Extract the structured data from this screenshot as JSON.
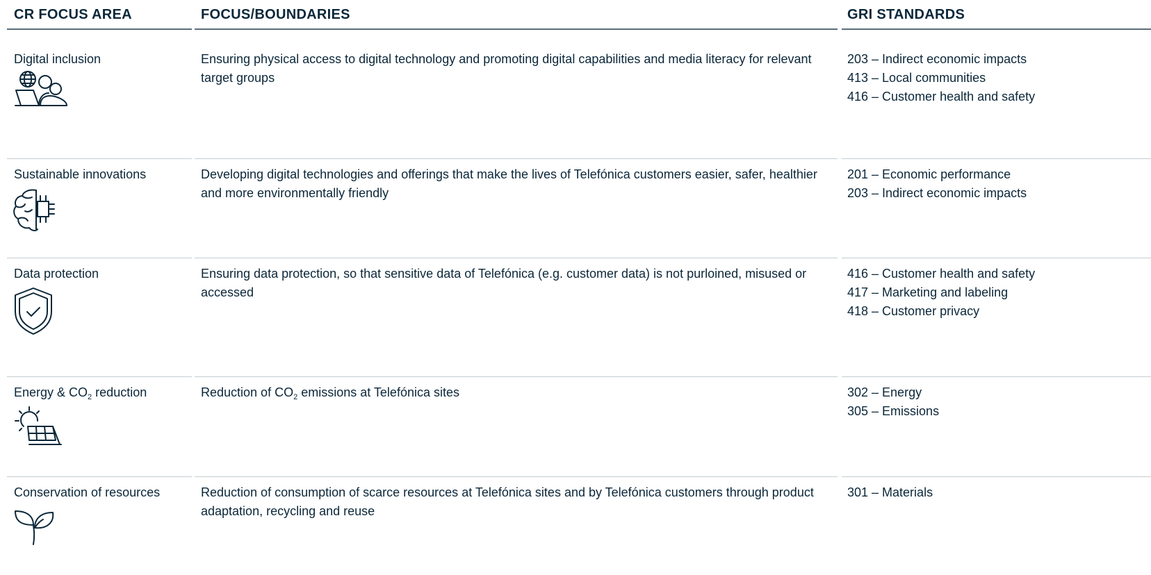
{
  "header": {
    "col_area": "CR FOCUS AREA",
    "col_focus": "FOCUS/BOUNDARIES",
    "col_gri": "GRI STANDARDS"
  },
  "rows": [
    {
      "area": "Digital inclusion",
      "icon": "globe-laptop-people-icon",
      "focus": "Ensuring physical access to digital technology and promoting digital capabilities and media literacy for relevant target groups",
      "gri": [
        "203 – Indirect economic impacts",
        "413 – Local communities",
        "416 – Customer health and safety"
      ]
    },
    {
      "area": "Sustainable innovations",
      "icon": "brain-chip-icon",
      "focus": "Developing digital technologies and offerings that make the lives of Telefónica customers easier, safer, healthier and more environmentally friendly",
      "gri": [
        "201 – Economic performance",
        "203 – Indirect economic impacts"
      ]
    },
    {
      "area": "Data protection",
      "icon": "shield-check-icon",
      "focus": "Ensuring data protection, so that sensitive data of Telefónica (e.g. customer data) is not purloined, misused or accessed",
      "gri": [
        "416 – Customer health and safety",
        "417 – Marketing and labeling",
        "418 – Customer privacy"
      ]
    },
    {
      "area_pre": "Energy & CO",
      "area_sub": "2",
      "area_post": " reduction",
      "icon": "sun-solar-panel-icon",
      "focus_pre": "Reduction of CO",
      "focus_sub": "2",
      "focus_post": " emissions at Telefónica sites",
      "gri": [
        "302 – Energy",
        "305 – Emissions"
      ]
    },
    {
      "area": "Conservation of resources",
      "icon": "sprout-leaves-icon",
      "focus": "Reduction of consumption of scarce resources at Telefónica sites and by Telefónica customers through product adaptation, recycling and reuse",
      "gri": [
        "301 – Materials"
      ]
    }
  ],
  "colors": {
    "text": "#0b2739",
    "header_rule": "#5a6e78",
    "row_rule": "#c4ccd1"
  }
}
